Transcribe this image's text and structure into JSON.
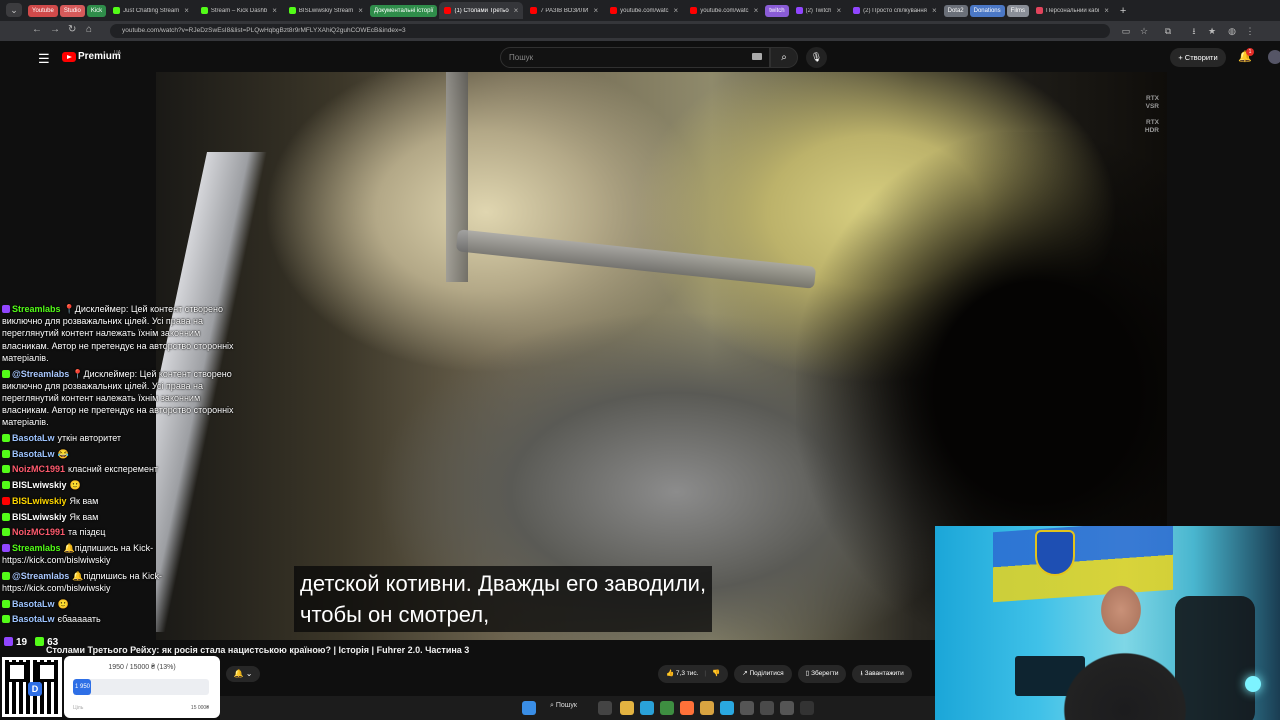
{
  "browser": {
    "groups": [
      "Youtube",
      "Studio",
      "Kick",
      "twitch",
      "Dota2",
      "Donations",
      "Films"
    ],
    "tabs": [
      {
        "title": "Just Chatting Stream",
        "fav": "#53fc18"
      },
      {
        "title": "Stream – Kick Dashb",
        "fav": "#53fc18"
      },
      {
        "title": "BISLwiwskiy Stream",
        "fav": "#53fc18"
      },
      {
        "title": "Документальні історії",
        "fav": "#2aa55a",
        "group": true
      },
      {
        "title": "(1) Столами Третьо",
        "fav": "#ff0000",
        "active": true
      },
      {
        "title": "7 РАЗІВ ВОЗИЛИ",
        "fav": "#ff0000"
      },
      {
        "title": "youtube.com/watc",
        "fav": "#ff0000"
      },
      {
        "title": "youtube.com/watc",
        "fav": "#ff0000"
      },
      {
        "title": "(2) Twitch",
        "fav": "#9146ff"
      },
      {
        "title": "(2) Просто спілкування",
        "fav": "#9146ff"
      },
      {
        "title": "Персональний кабі",
        "fav": "#e2445c"
      }
    ],
    "url": "youtube.com/watch?v=RJeDzSwEsI8&list=PLQwHqbgBzt8r9rMFLYXAhiQ2guhCOWEcB&index=3"
  },
  "youtube": {
    "brand": "Premium",
    "region": "UA",
    "search_placeholder": "Пошук",
    "create_label": "+ Створити",
    "notifications_count": "1",
    "video_title": "Столами Третього Рейху: як росія стала нацистською країною? | Історія | Fuhrer 2.0. Частина 3",
    "actions": {
      "likes": "7,3 тис.",
      "share": "Поділитися",
      "save": "Зберегти",
      "download": "Завантажити"
    },
    "overlay_badges": [
      {
        "line1": "RTX",
        "line2": "VSR"
      },
      {
        "line1": "RTX",
        "line2": "HDR"
      }
    ],
    "subtitles": [
      "детской котивни. Дважды его заводили,",
      "чтобы он смотрел,"
    ]
  },
  "chat": {
    "messages": [
      {
        "platform": "twitch",
        "nick": "Streamlabs",
        "nick_color": "#53fc18",
        "text": "📍Дисклеймер: Цей контент створено виключно для розважальних цілей. Усі права на переглянутий контент належать їхнім законним власникам. Автор не претендує на авторство сторонніх матеріалів."
      },
      {
        "platform": "kick",
        "nick": "@Streamlabs",
        "nick_color": "#a9c8ff",
        "text": "📍Дисклеймер: Цей контент створено виключно для розважальних цілей. Усі права на переглянутий контент належать їхнім законним власникам. Автор не претендує на авторство сторонніх матеріалів."
      },
      {
        "platform": "kick",
        "nick": "BasotaLw",
        "nick_color": "#9ec4ff",
        "text": "уткін авторитет"
      },
      {
        "platform": "kick",
        "nick": "BasotaLw",
        "nick_color": "#9ec4ff",
        "text": "😂"
      },
      {
        "platform": "kick",
        "nick": "NoizMC1991",
        "nick_color": "#ff5b6e",
        "text": "класний експеремент"
      },
      {
        "platform": "kick",
        "nick": "BISLwiwskiy",
        "nick_color": "#ffffff",
        "text": "🙂"
      },
      {
        "platform": "yt",
        "nick": "BISLwiwskiy",
        "nick_color": "#ffd700",
        "text": "Як вам"
      },
      {
        "platform": "kick",
        "nick": "BISLwiwskiy",
        "nick_color": "#ffffff",
        "text": "Як вам"
      },
      {
        "platform": "kick",
        "nick": "NoizMC1991",
        "nick_color": "#ff5b6e",
        "text": "та піздєц"
      },
      {
        "platform": "twitch",
        "nick": "Streamlabs",
        "nick_color": "#53fc18",
        "text": "🔔підпишись на Kick- https://kick.com/bislwiwskiy"
      },
      {
        "platform": "kick",
        "nick": "@Streamlabs",
        "nick_color": "#a9c8ff",
        "text": "🔔підпишись на Kick- https://kick.com/bislwiwskiy"
      },
      {
        "platform": "kick",
        "nick": "BasotaLw",
        "nick_color": "#9ec4ff",
        "text": "🙂"
      },
      {
        "platform": "kick",
        "nick": "BasotaLw",
        "nick_color": "#9ec4ff",
        "text": "єбааааать"
      }
    ],
    "viewers": {
      "twitch": "19",
      "kick": "63"
    }
  },
  "donation_goal": {
    "text": "1950 / 15000 ₴ (13%)",
    "fill_label": "1 950",
    "progress_percent": 13,
    "min_label": "Ціль",
    "max_label": "15 000₴",
    "qr_letter": "D"
  },
  "taskbar": {
    "search": "Пошук"
  },
  "colors": {
    "kick": "#53fc18",
    "twitch": "#9146ff",
    "youtube": "#ff0000",
    "accent": "#2e6fe6"
  }
}
